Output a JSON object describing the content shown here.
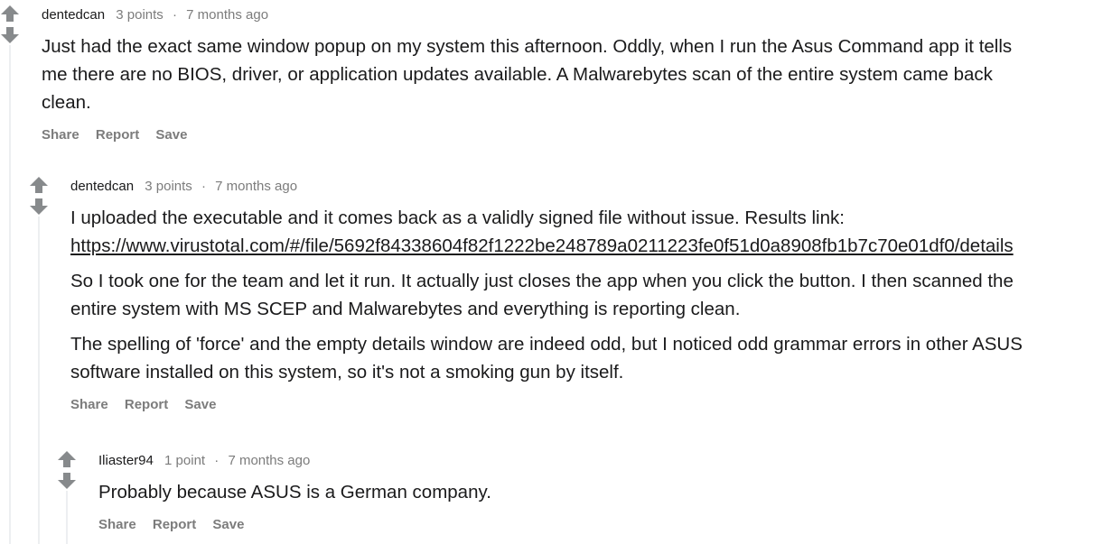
{
  "comments": [
    {
      "author": "dentedcan",
      "points": "3 points",
      "separator": "·",
      "time": "7 months ago",
      "lines": [
        "Just had the exact same window popup on my system this afternoon. Oddly, when I run the Asus Command app it tells",
        "me there are no BIOS, driver, or application updates available. A Malwarebytes scan of the entire system came back",
        "clean."
      ],
      "actions": {
        "share": "Share",
        "report": "Report",
        "save": "Save"
      }
    },
    {
      "author": "dentedcan",
      "points": "3 points",
      "separator": "·",
      "time": "7 months ago",
      "p1_line1": "I uploaded the executable and it comes back as a validly signed file without issue. Results link:",
      "link": "https://www.virustotal.com/#/file/5692f84338604f82f1222be248789a0211223fe0f51d0a8908fb1b7c70e01df0/details",
      "p2_lines": [
        "So I took one for the team and let it run. It actually just closes the app when you click the button. I then scanned the",
        "entire system with MS SCEP and Malwarebytes and everything is reporting clean."
      ],
      "p3_lines": [
        "The spelling of 'force' and the empty details window are indeed odd, but I noticed odd grammar errors in other ASUS",
        "software installed on this system, so it's not a smoking gun by itself."
      ],
      "actions": {
        "share": "Share",
        "report": "Report",
        "save": "Save"
      }
    },
    {
      "author": "Iliaster94",
      "points": "1 point",
      "separator": "·",
      "time": "7 months ago",
      "text": "Probably because ASUS is a German company.",
      "actions": {
        "share": "Share",
        "report": "Report",
        "save": "Save"
      }
    }
  ],
  "icons": {
    "upvote": "upvote-arrow-icon",
    "downvote": "downvote-arrow-icon"
  },
  "colors": {
    "arrow": "#878a8c",
    "rail": "#edeff1",
    "meta": "#7c7c7c",
    "text": "#1a1a1b"
  }
}
